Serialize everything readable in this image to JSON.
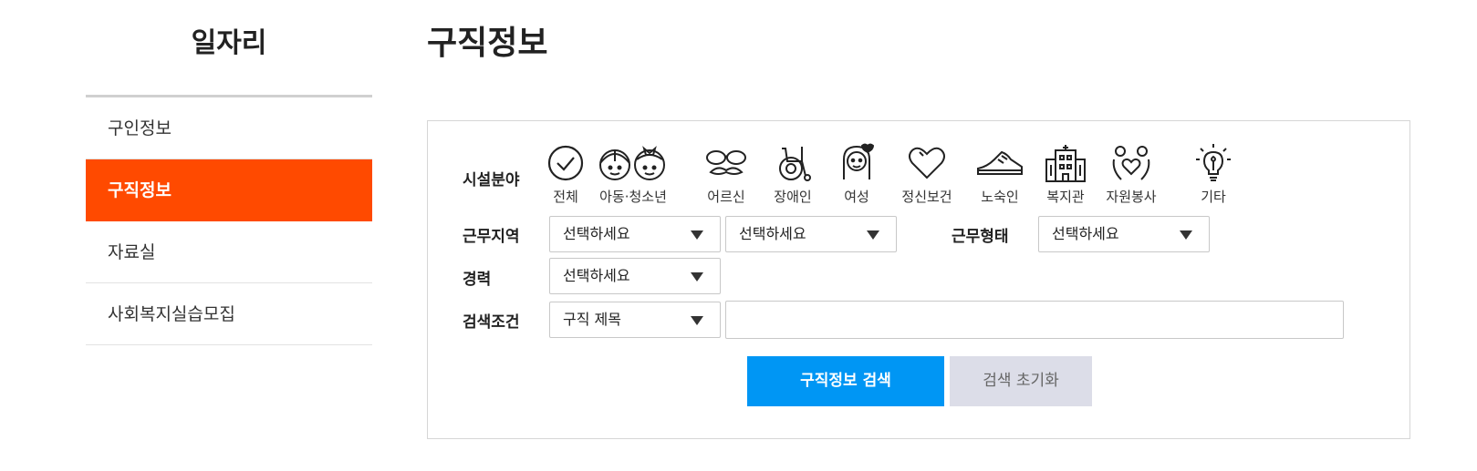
{
  "sidebar": {
    "title": "일자리",
    "items": [
      {
        "label": "구인정보"
      },
      {
        "label": "구직정보"
      },
      {
        "label": "자료실"
      },
      {
        "label": "사회복지실습모집"
      }
    ]
  },
  "page_title": "구직정보",
  "filters": {
    "facility_label": "시설분야",
    "categories": [
      {
        "label": "전체",
        "icon": "check-circle-icon"
      },
      {
        "label": "아동·청소년",
        "icon": "children-icon"
      },
      {
        "label": "어르신",
        "icon": "glasses-mustache-icon"
      },
      {
        "label": "장애인",
        "icon": "wheelchair-icon"
      },
      {
        "label": "여성",
        "icon": "woman-icon"
      },
      {
        "label": "정신보건",
        "icon": "heart-icon"
      },
      {
        "label": "노숙인",
        "icon": "shoe-icon"
      },
      {
        "label": "복지관",
        "icon": "building-icon"
      },
      {
        "label": "자원봉사",
        "icon": "volunteer-hands-icon"
      },
      {
        "label": "기타",
        "icon": "lightbulb-icon"
      }
    ],
    "work_area_label": "근무지역",
    "work_area_1": "선택하세요",
    "work_area_2": "선택하세요",
    "work_type_label": "근무형태",
    "work_type": "선택하세요",
    "career_label": "경력",
    "career": "선택하세요",
    "search_condition_label": "검색조건",
    "search_condition": "구직 제목",
    "search_text": ""
  },
  "buttons": {
    "search": "구직정보 검색",
    "reset": "검색 초기화"
  },
  "colors": {
    "accent": "#ff4a00",
    "primary_button": "#0096f4",
    "reset_button": "#dcdde8"
  }
}
